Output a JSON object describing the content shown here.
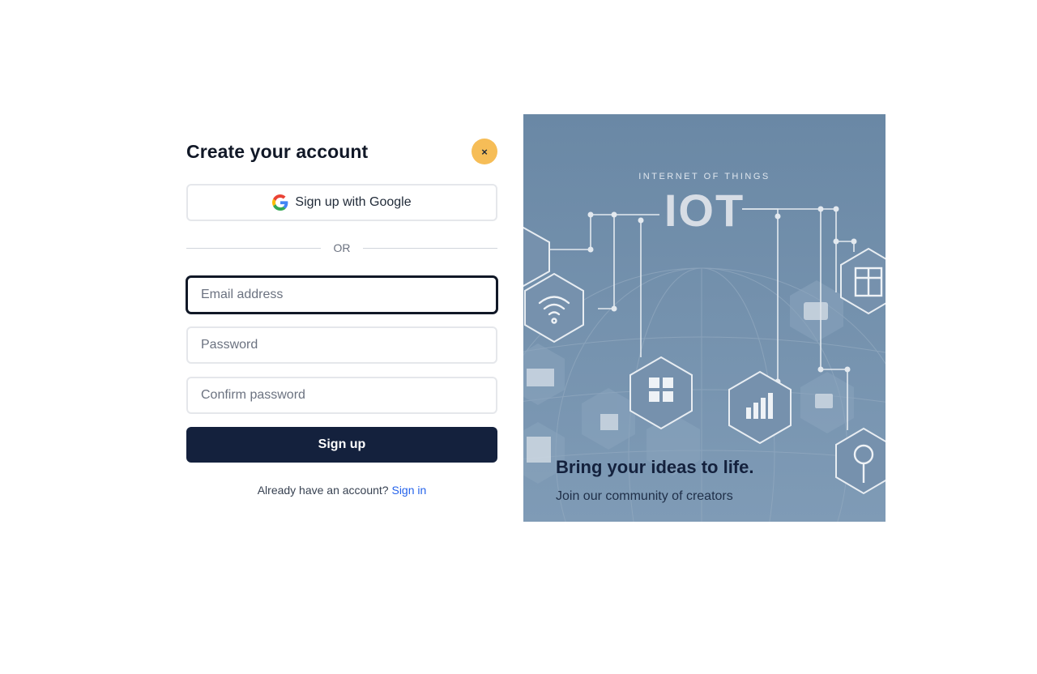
{
  "modal": {
    "title": "Create your account",
    "close_label": "×",
    "google_button_label": "Sign up with Google",
    "divider_text": "OR",
    "fields": {
      "email_placeholder": "Email address",
      "password_placeholder": "Password",
      "confirm_placeholder": "Confirm password"
    },
    "submit_label": "Sign up",
    "signin_prompt": "Already have an account?",
    "signin_link": "Sign in"
  },
  "hero": {
    "illustration_subtitle": "INTERNET OF THINGS",
    "illustration_title": "IOT",
    "headline": "Bring your ideas to life.",
    "subline": "Join our community of creators"
  },
  "colors": {
    "accent_close": "#f6bd57",
    "primary_button": "#14213d",
    "link": "#2563eb",
    "hero_bg": "#6f8ca8"
  }
}
